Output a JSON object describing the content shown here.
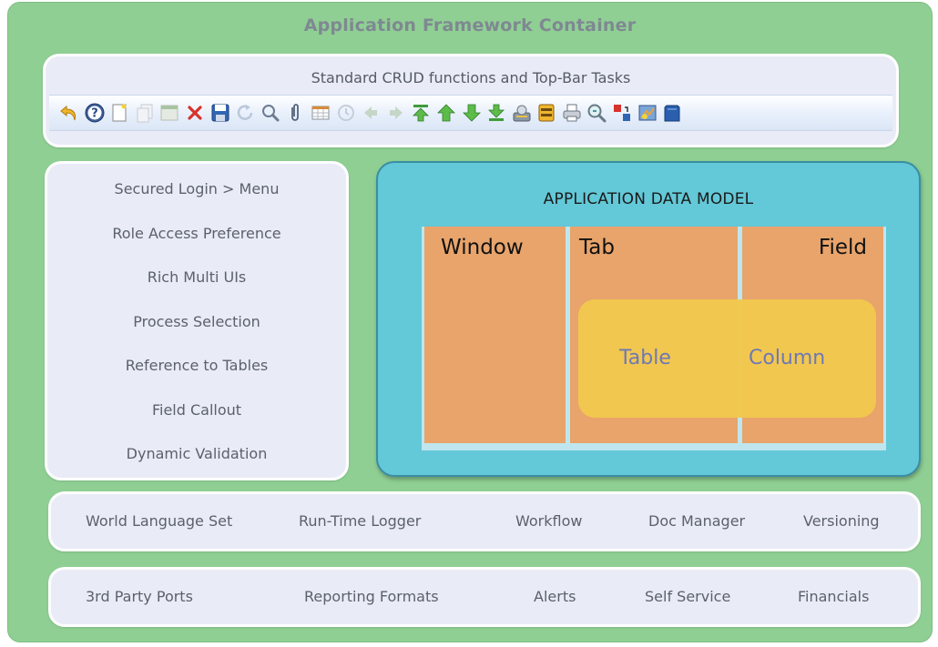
{
  "container": {
    "title": "Application Framework Container"
  },
  "toolbar": {
    "title": "Standard CRUD functions and Top-Bar Tasks",
    "icons": [
      "undo-icon",
      "help-icon",
      "new-record-icon",
      "copy-icon",
      "multi-record-icon",
      "delete-icon",
      "save-icon",
      "refresh-icon",
      "find-icon",
      "attachment-icon",
      "grid-toggle-icon",
      "history-icon",
      "parent-record-icon",
      "detail-record-icon",
      "first-record-icon",
      "previous-record-icon",
      "next-record-icon",
      "last-record-icon",
      "report-icon",
      "archive-icon",
      "print-icon",
      "zoom-across-icon",
      "request-icon",
      "product-info-icon",
      "end-icon"
    ]
  },
  "features": {
    "items": [
      "Secured Login > Menu",
      "Role Access Preference",
      "Rich Multi UIs",
      "Process Selection",
      "Reference to Tables",
      "Field Callout",
      "Dynamic Validation"
    ]
  },
  "data_model": {
    "title": "APPLICATION DATA MODEL",
    "columns": {
      "window": "Window",
      "tab": "Tab",
      "field": "Field"
    },
    "inner": {
      "table": "Table",
      "column": "Column"
    }
  },
  "services_row_1": {
    "items": [
      "World Language Set",
      "Run-Time Logger",
      "Workflow",
      "Doc Manager",
      "Versioning"
    ]
  },
  "services_row_2": {
    "items": [
      "3rd Party Ports",
      "Reporting Formats",
      "Alerts",
      "Self Service",
      "Financials"
    ]
  },
  "colors": {
    "container": "#8fcf93",
    "panel": "#e9ecf7",
    "data_model": "#63c8d7",
    "column_fill": "#e8a46b",
    "table_band": "#f2c94f",
    "inner_text": "#6b77b8"
  }
}
